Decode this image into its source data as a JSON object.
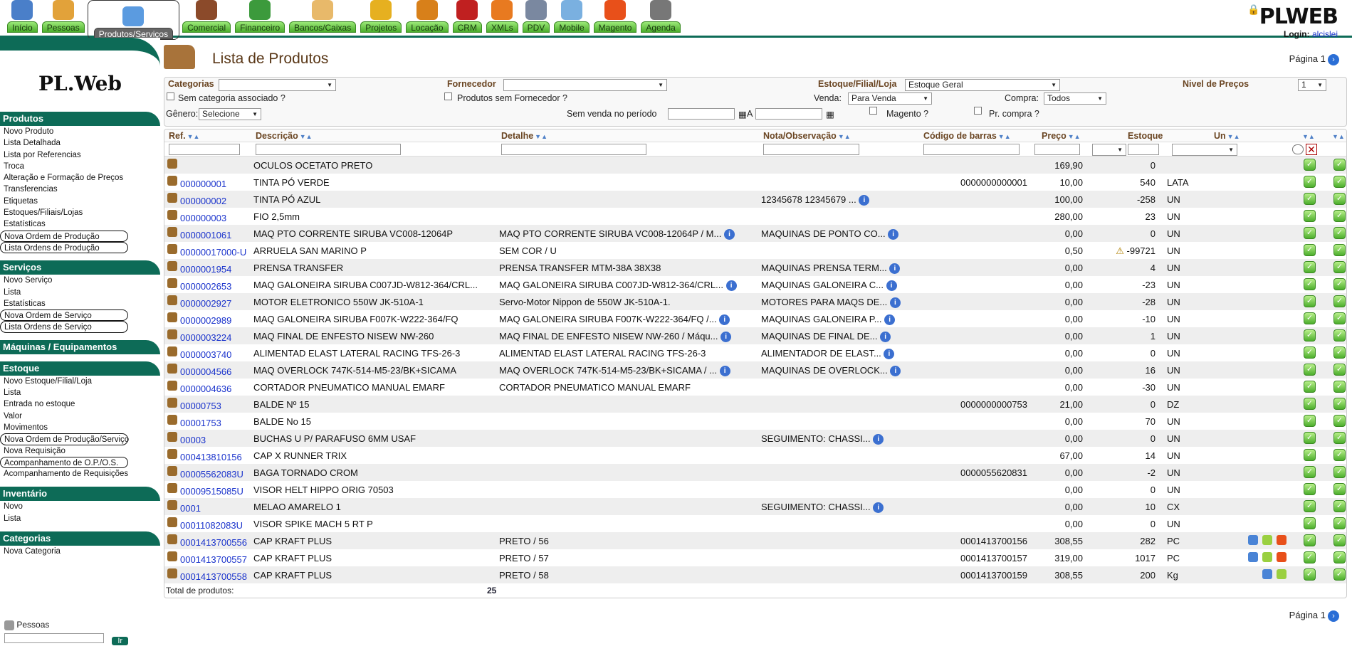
{
  "nav": [
    {
      "label": "Início",
      "color": "#4a7fc9"
    },
    {
      "label": "Pessoas",
      "color": "#e2a23a"
    },
    {
      "label": "Produtos/Serviços",
      "color": "#5b9be0",
      "active": true
    },
    {
      "label": "Comercial",
      "color": "#8b4a2a"
    },
    {
      "label": "Financeiro",
      "color": "#3c9a3c"
    },
    {
      "label": "Bancos/Caixas",
      "color": "#e8b96a"
    },
    {
      "label": "Projetos",
      "color": "#e6b020"
    },
    {
      "label": "Locação",
      "color": "#d8801a"
    },
    {
      "label": "CRM",
      "color": "#c02020"
    },
    {
      "label": "XMLs",
      "color": "#e87a20"
    },
    {
      "label": "PDV",
      "color": "#7a88a0"
    },
    {
      "label": "Mobile",
      "color": "#7ab0e0"
    },
    {
      "label": "Magento",
      "color": "#e8501a"
    },
    {
      "label": "Agenda",
      "color": "#777777"
    }
  ],
  "brand": {
    "logo": "PLWEB",
    "login_label": "Login:",
    "login_user": "alcislei"
  },
  "sidebar": {
    "logo": "PL.Web",
    "sections": [
      {
        "title": "Produtos",
        "items": [
          "Novo Produto",
          "Lista Detalhada",
          "Lista por Referencias",
          "Troca",
          "Alteração e Formação de Preços",
          "Transferencias",
          "Etiquetas",
          "Estoques/Filiais/Lojas",
          "Estatísticas",
          "Nova Ordem de Produção",
          "Lista Ordens de Produção"
        ]
      },
      {
        "title": "Serviços",
        "items": [
          "Novo Serviço",
          "Lista",
          "Estatísticas",
          "Nova Ordem de Serviço",
          "Lista Ordens de Serviço"
        ]
      },
      {
        "title": "Máquinas / Equipamentos",
        "items": []
      },
      {
        "title": "Estoque",
        "items": [
          "Novo Estoque/Filial/Loja",
          "Lista",
          "Entrada no estoque",
          "Valor",
          "Movimentos",
          "Nova Ordem de Produção/Serviço",
          "Nova Requisição",
          "Acompanhamento de O.P./O.S.",
          "Acompanhamento de Requisições"
        ]
      },
      {
        "title": "Inventário",
        "items": [
          "Novo",
          "Lista"
        ]
      },
      {
        "title": "Categorias",
        "items": [
          "Nova Categoria"
        ]
      }
    ],
    "footer": {
      "label": "Pessoas",
      "go": "Ir"
    }
  },
  "page": {
    "title": "Lista de Produtos",
    "pagina": "Página 1"
  },
  "filters": {
    "categorias": "Categorias",
    "fornecedor": "Fornecedor",
    "estoque": "Estoque/Filial/Loja",
    "estoque_val": "Estoque Geral",
    "nivel": "Nivel de Preços",
    "nivel_val": "1",
    "sem_cat": "Sem categoria associado ?",
    "sem_forn": "Produtos sem Fornecedor ?",
    "venda": "Venda:",
    "venda_val": "Para Venda",
    "compra": "Compra:",
    "compra_val": "Todos",
    "genero": "Gênero:",
    "genero_val": "Selecione",
    "sem_venda": "Sem venda no período",
    "a": "A",
    "magento": "Magento ?",
    "pr_compra": "Pr. compra ?"
  },
  "columns": {
    "ref": "Ref.",
    "desc": "Descrição",
    "det": "Detalhe",
    "nota": "Nota/Observação",
    "cod": "Código de barras",
    "preco": "Preço",
    "estoque": "Estoque",
    "un": "Un"
  },
  "rows": [
    {
      "ref": "",
      "desc": "OCULOS OCETATO PRETO",
      "det": "",
      "nota": "",
      "cod": "",
      "preco": "169,90",
      "est": "0",
      "un": ""
    },
    {
      "ref": "000000001",
      "desc": "TINTA PÓ VERDE",
      "det": "",
      "nota": "",
      "cod": "0000000000001",
      "preco": "10,00",
      "est": "540",
      "un": "LATA"
    },
    {
      "ref": "000000002",
      "desc": "TINTA PÓ AZUL",
      "det": "",
      "nota": "12345678 12345679 ...",
      "ni": true,
      "cod": "",
      "preco": "100,00",
      "est": "-258",
      "un": "UN"
    },
    {
      "ref": "000000003",
      "desc": "FIO 2,5mm",
      "det": "",
      "nota": "",
      "cod": "",
      "preco": "280,00",
      "est": "23",
      "un": "UN"
    },
    {
      "ref": "0000001061",
      "desc": "MAQ PTO CORRENTE SIRUBA VC008-12064P",
      "det": "MAQ PTO CORRENTE SIRUBA VC008-12064P / M...",
      "di": true,
      "nota": "MAQUINAS DE PONTO CO...",
      "ni": true,
      "cod": "",
      "preco": "0,00",
      "est": "0",
      "un": "UN"
    },
    {
      "ref": "00000017000-U",
      "desc": "ARRUELA SAN MARINO P",
      "det": "SEM COR / U",
      "nota": "",
      "cod": "",
      "preco": "0,50",
      "est": "-99721",
      "un": "UN",
      "warn": true
    },
    {
      "ref": "0000001954",
      "desc": "PRENSA TRANSFER",
      "det": "PRENSA TRANSFER MTM-38A 38X38",
      "nota": "MAQUINAS PRENSA TERM...",
      "ni": true,
      "cod": "",
      "preco": "0,00",
      "est": "4",
      "un": "UN"
    },
    {
      "ref": "0000002653",
      "desc": "MAQ GALONEIRA SIRUBA C007JD-W812-364/CRL...",
      "det": "MAQ GALONEIRA SIRUBA C007JD-W812-364/CRL...",
      "di": true,
      "nota": "MAQUINAS GALONEIRA C...",
      "ni": true,
      "cod": "",
      "preco": "0,00",
      "est": "-23",
      "un": "UN"
    },
    {
      "ref": "0000002927",
      "desc": "MOTOR ELETRONICO 550W JK-510A-1",
      "det": "Servo-Motor Nippon de 550W JK-510A-1.",
      "nota": "MOTORES PARA MAQS DE...",
      "ni": true,
      "cod": "",
      "preco": "0,00",
      "est": "-28",
      "un": "UN"
    },
    {
      "ref": "0000002989",
      "desc": "MAQ GALONEIRA SIRUBA F007K-W222-364/FQ",
      "det": "MAQ GALONEIRA SIRUBA F007K-W222-364/FQ /...",
      "di": true,
      "nota": "MAQUINAS GALONEIRA P...",
      "ni": true,
      "cod": "",
      "preco": "0,00",
      "est": "-10",
      "un": "UN"
    },
    {
      "ref": "0000003224",
      "desc": "MAQ FINAL DE ENFESTO NISEW NW-260",
      "det": "MAQ FINAL DE ENFESTO NISEW NW-260 / Máqu...",
      "di": true,
      "nota": "MAQUINAS DE FINAL DE...",
      "ni": true,
      "cod": "",
      "preco": "0,00",
      "est": "1",
      "un": "UN"
    },
    {
      "ref": "0000003740",
      "desc": "ALIMENTAD ELAST LATERAL RACING TFS-26-3",
      "det": "ALIMENTAD ELAST LATERAL RACING TFS-26-3",
      "nota": "ALIMENTADOR DE ELAST...",
      "ni": true,
      "cod": "",
      "preco": "0,00",
      "est": "0",
      "un": "UN"
    },
    {
      "ref": "0000004566",
      "desc": "MAQ OVERLOCK 747K-514-M5-23/BK+SICAMA",
      "det": "MAQ OVERLOCK 747K-514-M5-23/BK+SICAMA / ...",
      "di": true,
      "nota": "MAQUINAS DE OVERLOCK...",
      "ni": true,
      "cod": "",
      "preco": "0,00",
      "est": "16",
      "un": "UN"
    },
    {
      "ref": "0000004636",
      "desc": "CORTADOR PNEUMATICO MANUAL EMARF",
      "det": "CORTADOR PNEUMATICO MANUAL EMARF",
      "nota": "",
      "cod": "",
      "preco": "0,00",
      "est": "-30",
      "un": "UN"
    },
    {
      "ref": "00000753",
      "desc": "BALDE Nº 15",
      "det": "",
      "nota": "",
      "cod": "0000000000753",
      "preco": "21,00",
      "est": "0",
      "un": "DZ"
    },
    {
      "ref": "00001753",
      "desc": "BALDE No 15",
      "det": "",
      "nota": "",
      "cod": "",
      "preco": "0,00",
      "est": "70",
      "un": "UN"
    },
    {
      "ref": "00003",
      "desc": "BUCHAS U P/ PARAFUSO 6MM USAF",
      "det": "",
      "nota": "SEGUIMENTO:  CHASSI...",
      "ni": true,
      "cod": "",
      "preco": "0,00",
      "est": "0",
      "un": "UN"
    },
    {
      "ref": "000413810156",
      "desc": "CAP X RUNNER TRIX",
      "det": "",
      "nota": "",
      "cod": "",
      "preco": "67,00",
      "est": "14",
      "un": "UN"
    },
    {
      "ref": "00005562083U",
      "desc": "BAGA TORNADO CROM",
      "det": "",
      "nota": "",
      "cod": "0000055620831",
      "preco": "0,00",
      "est": "-2",
      "un": "UN"
    },
    {
      "ref": "00009515085U",
      "desc": "VISOR HELT HIPPO ORIG 70503",
      "det": "",
      "nota": "",
      "cod": "",
      "preco": "0,00",
      "est": "0",
      "un": "UN"
    },
    {
      "ref": "0001",
      "desc": "MELAO AMARELO 1",
      "det": "",
      "nota": "SEGUIMENTO:  CHASSI...",
      "ni": true,
      "cod": "",
      "preco": "0,00",
      "est": "10",
      "un": "CX"
    },
    {
      "ref": "00011082083U",
      "desc": "VISOR SPIKE MACH 5 RT P",
      "det": "",
      "nota": "",
      "cod": "",
      "preco": "0,00",
      "est": "0",
      "un": "UN"
    },
    {
      "ref": "0001413700556",
      "desc": "CAP KRAFT PLUS",
      "det": "PRETO / 56",
      "nota": "",
      "cod": "0001413700156",
      "preco": "308,55",
      "est": "282",
      "un": "PC",
      "ext": 3
    },
    {
      "ref": "0001413700557",
      "desc": "CAP KRAFT PLUS",
      "det": "PRETO / 57",
      "nota": "",
      "cod": "0001413700157",
      "preco": "319,00",
      "est": "1017",
      "un": "PC",
      "ext": 3
    },
    {
      "ref": "0001413700558",
      "desc": "CAP KRAFT PLUS",
      "det": "PRETO / 58",
      "nota": "",
      "cod": "0001413700159",
      "preco": "308,55",
      "est": "200",
      "un": "Kg",
      "ext": 2
    }
  ],
  "total": {
    "label": "Total de produtos:",
    "value": "25"
  }
}
